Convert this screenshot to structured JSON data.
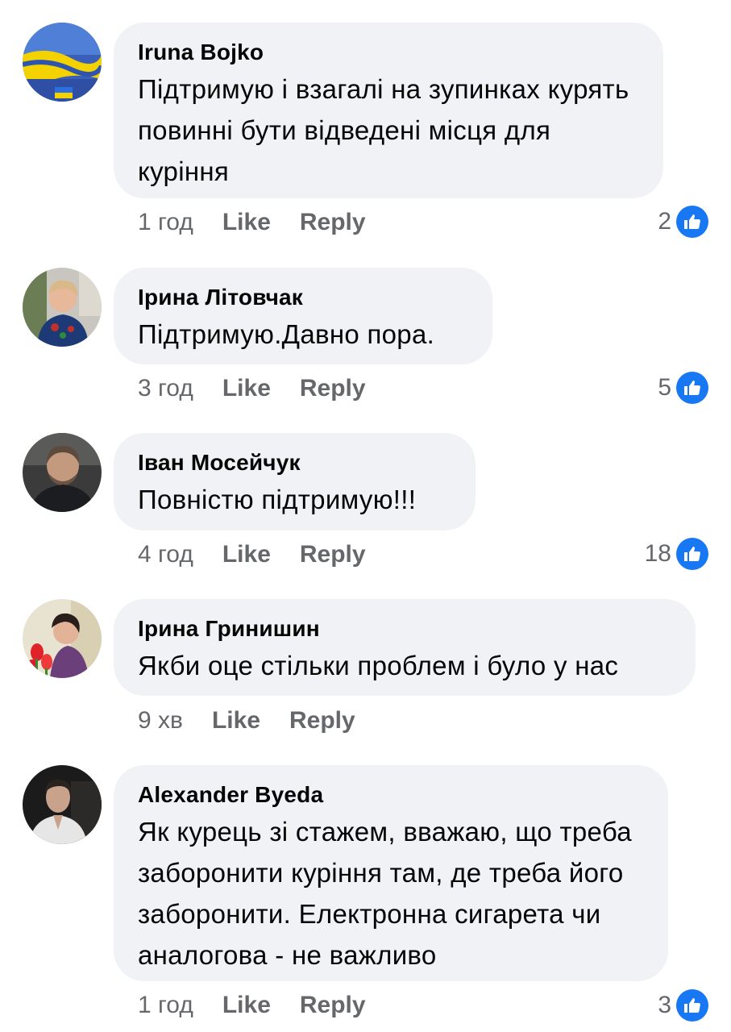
{
  "comments": [
    {
      "author": "Iruna Bojko",
      "text": "Підтримую і взагалі на зупинках курять повинні бути відведені місця для куріння",
      "time": "1 год",
      "like_label": "Like",
      "reply_label": "Reply",
      "reactions": "2",
      "reaction_icon": "like-icon"
    },
    {
      "author": "Ірина Літовчак",
      "text": "Підтримую.Давно пора.",
      "time": "3 год",
      "like_label": "Like",
      "reply_label": "Reply",
      "reactions": "5",
      "reaction_icon": "like-icon"
    },
    {
      "author": "Іван Мосейчук",
      "text": "Повністю підтримую!!!",
      "time": "4 год",
      "like_label": "Like",
      "reply_label": "Reply",
      "reactions": "18",
      "reaction_icon": "like-icon"
    },
    {
      "author": "Ірина Гринишин",
      "text": "Якби оце стільки проблем і було у нас",
      "time": "9 хв",
      "like_label": "Like",
      "reply_label": "Reply",
      "reactions": null
    },
    {
      "author": "Alexander Byeda",
      "text": "Як курець зі стажем, вважаю, що треба заборонити куріння там, де треба його заборонити. Електронна сигарета чи аналогова - не важливо",
      "time": "1 год",
      "like_label": "Like",
      "reply_label": "Reply",
      "reactions": "3",
      "reaction_icon": "like-icon"
    }
  ],
  "colors": {
    "bubble": "#f0f2f5",
    "meta_text": "#65676b",
    "like_blue": "#1877f2",
    "text": "#050505"
  }
}
